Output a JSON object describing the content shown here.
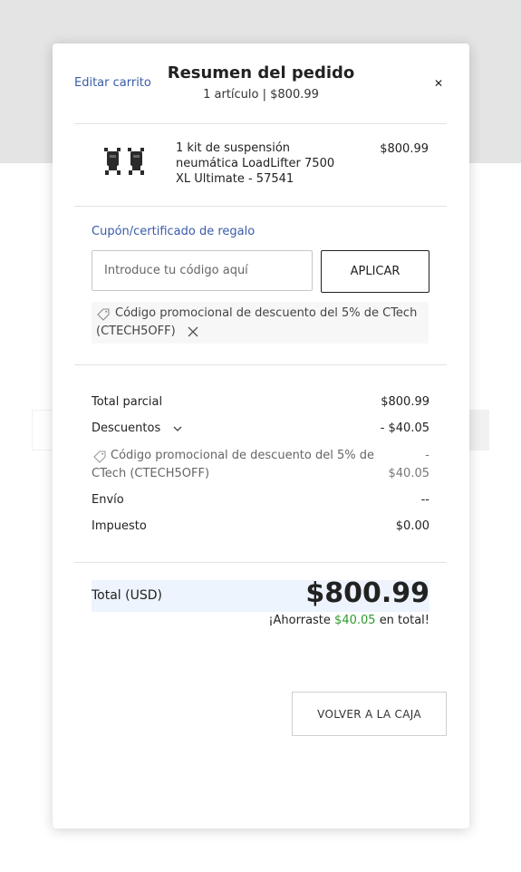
{
  "modal": {
    "edit_cart_label": "Editar carrito",
    "title": "Resumen del pedido",
    "subtitle": "1 artículo | $800.99",
    "close_icon": "close-icon"
  },
  "item": {
    "name": "1 kit de suspensión neumática LoadLifter 7500 XL Ultimate - 57541",
    "price": "$800.99",
    "image_icon": "air-suspension-kit-image"
  },
  "coupon": {
    "label": "Cupón/certificado de regalo",
    "input_value": "",
    "placeholder": "Introduce tu código aquí",
    "apply_label": "APLICAR",
    "applied_promo": "Código promocional de descuento del 5% de CTech (CTECH5OFF)",
    "tag_icon": "tag-icon",
    "remove_icon": "close-icon"
  },
  "summary": {
    "subtotal_label": "Total parcial",
    "subtotal_value": "$800.99",
    "discounts_label": "Descuentos",
    "discounts_value": "- $40.05",
    "discount_detail_label": "Código promocional de descuento del 5% de CTech (CTECH5OFF)",
    "discount_detail_value_sign": "-",
    "discount_detail_value": "$40.05",
    "shipping_label": "Envío",
    "shipping_value": "--",
    "tax_label": "Impuesto",
    "tax_value": "$0.00"
  },
  "total": {
    "label": "Total (USD)",
    "value": "$800.99",
    "savings_prefix": "¡Ahorraste",
    "savings_amount": "$40.05",
    "savings_suffix": "en total!"
  },
  "back_button_label": "VOLVER A LA CAJA",
  "colors": {
    "link": "#3a5ba8",
    "savings_green": "#2e9b2e",
    "total_band": "#eef4fd"
  }
}
